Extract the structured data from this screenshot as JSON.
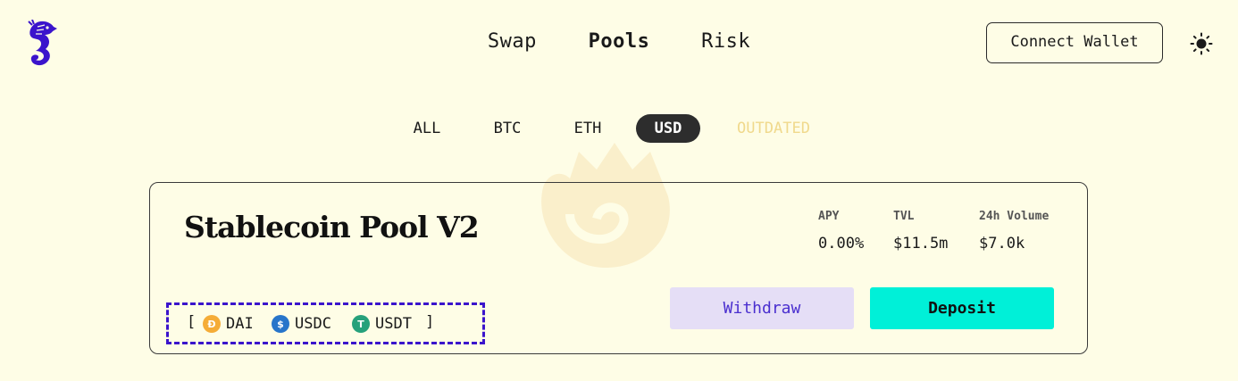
{
  "nav": {
    "items": [
      {
        "label": "Swap",
        "active": false
      },
      {
        "label": "Pools",
        "active": true
      },
      {
        "label": "Risk",
        "active": false
      }
    ]
  },
  "header": {
    "connect_label": "Connect Wallet",
    "logo_icon": "seahorse-logo-icon",
    "theme_icon": "sun-icon"
  },
  "filters": {
    "items": [
      {
        "label": "ALL",
        "state": "normal"
      },
      {
        "label": "BTC",
        "state": "normal"
      },
      {
        "label": "ETH",
        "state": "normal"
      },
      {
        "label": "USD",
        "state": "active"
      },
      {
        "label": "OUTDATED",
        "state": "muted"
      }
    ]
  },
  "pool": {
    "title": "Stablecoin Pool V2",
    "stats": [
      {
        "label": "APY",
        "value": "0.00%"
      },
      {
        "label": "TVL",
        "value": "$11.5m"
      },
      {
        "label": "24h Volume",
        "value": "$7.0k"
      }
    ],
    "tokens": {
      "open": "[",
      "close": "]",
      "items": [
        {
          "symbol": "DAI",
          "icon": "dai-icon",
          "color": "#f5ac37"
        },
        {
          "symbol": "USDC",
          "icon": "usdc-icon",
          "color": "#2775ca"
        },
        {
          "symbol": "USDT",
          "icon": "usdt-icon",
          "color": "#26a17b"
        }
      ]
    },
    "withdraw_label": "Withdraw",
    "deposit_label": "Deposit"
  },
  "colors": {
    "background": "#fefde6",
    "accent_purple": "#3b14cc",
    "deposit_teal": "#00f0d8",
    "withdraw_lavender": "#e5def6"
  }
}
